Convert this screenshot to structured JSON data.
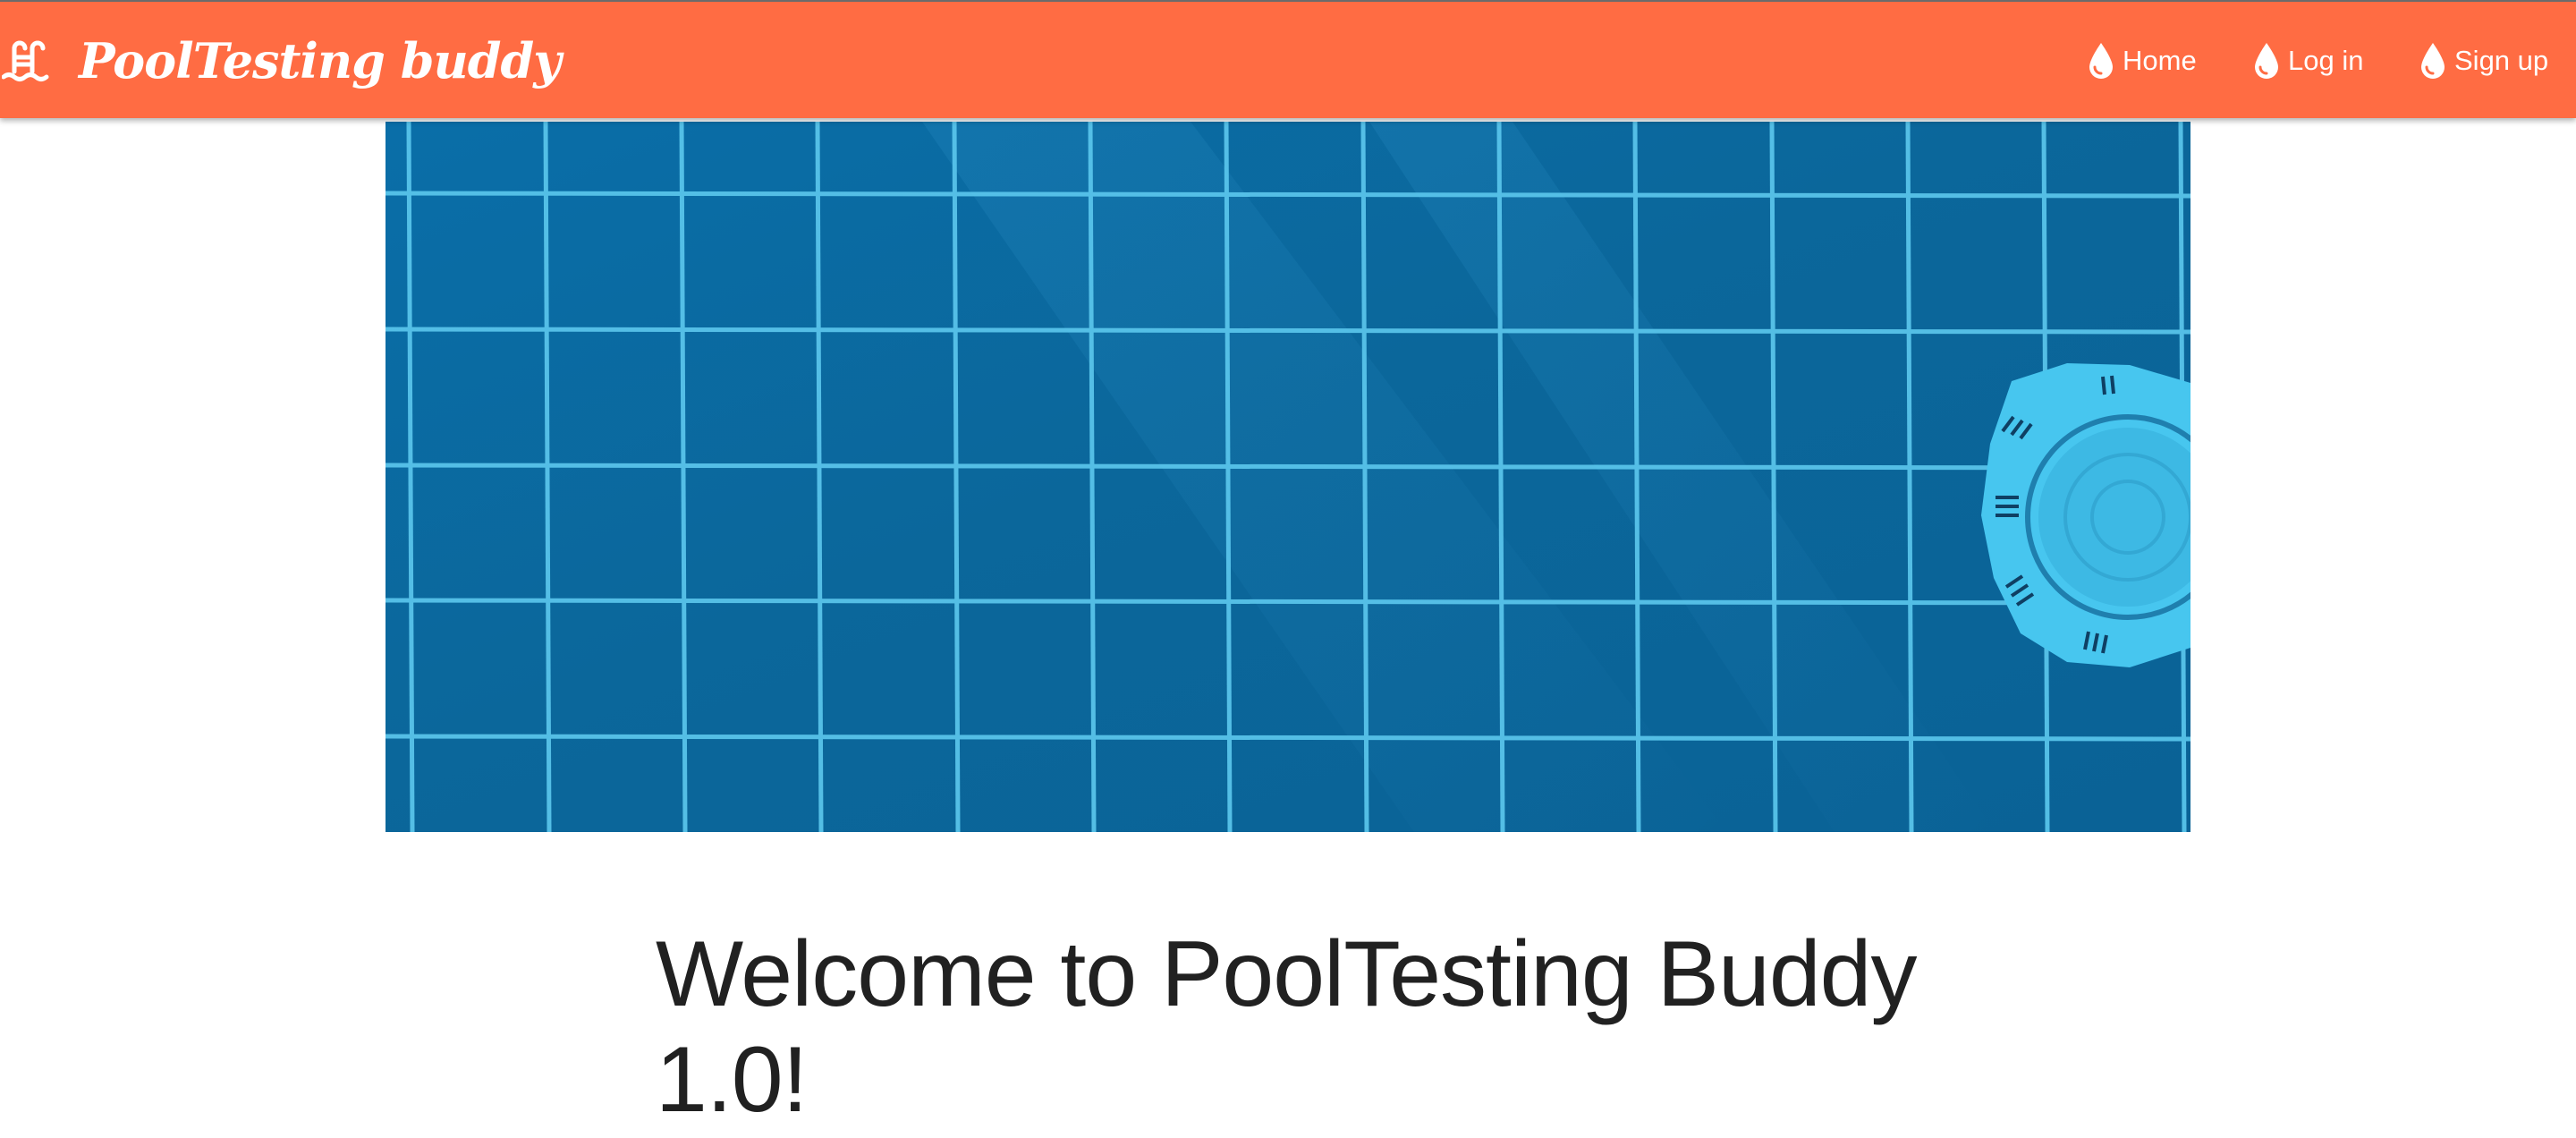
{
  "navbar": {
    "brand": {
      "icon": "swimming-pool-icon",
      "name": "PoolTesting buddy"
    },
    "links": [
      {
        "icon": "water-drop-icon",
        "label": "Home"
      },
      {
        "icon": "water-drop-icon",
        "label": "Log in"
      },
      {
        "icon": "water-drop-icon",
        "label": "Sign up"
      }
    ],
    "background_color": "#ff6c43",
    "text_color": "#ffffff"
  },
  "hero": {
    "image": "pool-tiles-with-underwater-light",
    "tile_color": "#0b6fa6",
    "grout_color": "#5cc8ee"
  },
  "main": {
    "heading": "Welcome to PoolTesting Buddy 1.0!"
  }
}
